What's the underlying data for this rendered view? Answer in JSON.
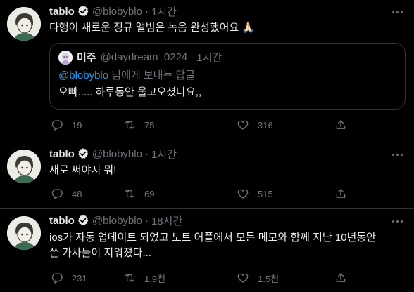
{
  "tweets": [
    {
      "author": "tablo",
      "handle": "@blobyblo",
      "dot": "·",
      "time": "1시간",
      "text": "다행이 새로운 정규 앨범은 녹음 완성했어요 🙏🏻",
      "quote": {
        "author": "미주",
        "handle": "@daydream_0224",
        "dot": "·",
        "time": "1시간",
        "reply_mention": "@blobyblo",
        "reply_suffix": " 님에게 보내는 답글",
        "text": "오빠..... 하루동안 울고오셨나요,,"
      },
      "replies": "19",
      "retweets": "75",
      "likes": "316"
    },
    {
      "author": "tablo",
      "handle": "@blobyblo",
      "dot": "·",
      "time": "1시간",
      "text": "새로 써야지 뭐!",
      "replies": "48",
      "retweets": "69",
      "likes": "515"
    },
    {
      "author": "tablo",
      "handle": "@blobyblo",
      "dot": "·",
      "time": "18시간",
      "text_line1": "ios가 자동 업데이트 되었고 노트 어플에서 모든 메모와 함께 지난 10년동안",
      "text_line2": "쓴 가사들이 지워졌다...",
      "replies": "231",
      "retweets": "1.9천",
      "likes": "1.5천"
    }
  ],
  "icons": {
    "verified": "verified-badge-icon",
    "reply": "reply-icon",
    "retweet": "retweet-icon",
    "like": "heart-icon",
    "share": "share-icon",
    "more": "more-icon"
  },
  "colors": {
    "background": "#000000",
    "text": "#e7e9ea",
    "muted": "#71767b",
    "border": "#2f3336",
    "accent": "#1d9bf0"
  }
}
